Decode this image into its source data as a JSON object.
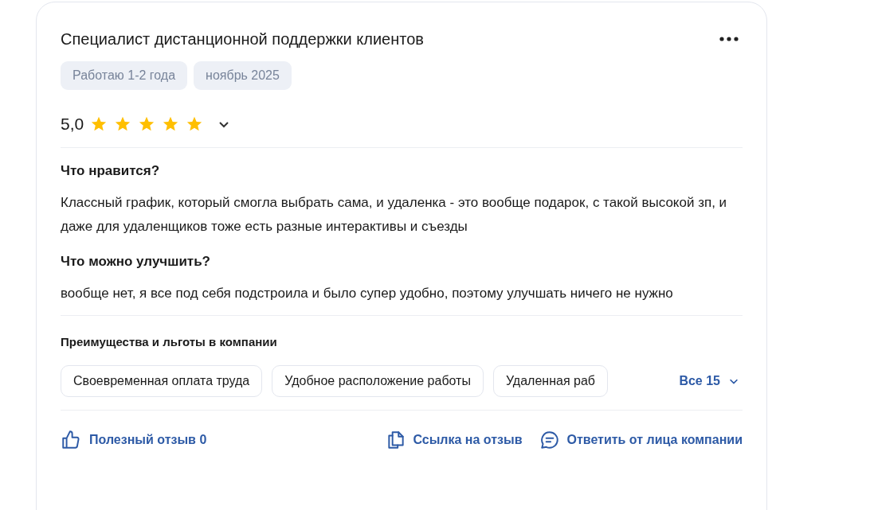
{
  "review": {
    "title": "Специалист дистанционной поддержки клиентов",
    "tags": [
      "Работаю 1-2 года",
      "ноябрь 2025"
    ],
    "rating": {
      "value": "5,0",
      "stars": 5
    },
    "sections": [
      {
        "heading": "Что нравится?",
        "text": "Классный график, который смогла выбрать сама, и удаленка - это вообще подарок, с такой высокой зп, и даже для удаленщиков тоже есть разные интерактивы и съезды"
      },
      {
        "heading": "Что можно улучшить?",
        "text": "вообще нет, я все под себя подстроила и было супер удобно, поэтому улучшать ничего не нужно"
      }
    ],
    "benefits": {
      "heading": "Преимущества и льготы в компании",
      "items": [
        "Своевременная оплата труда",
        "Удобное расположение работы",
        "Удаленная раб"
      ],
      "more": "Все 15"
    },
    "actions": [
      {
        "kind": "like",
        "label": "Полезный отзыв 0"
      },
      {
        "kind": "link",
        "label": "Ссылка на отзыв"
      },
      {
        "kind": "reply",
        "label": "Ответить от лица компании"
      }
    ]
  }
}
